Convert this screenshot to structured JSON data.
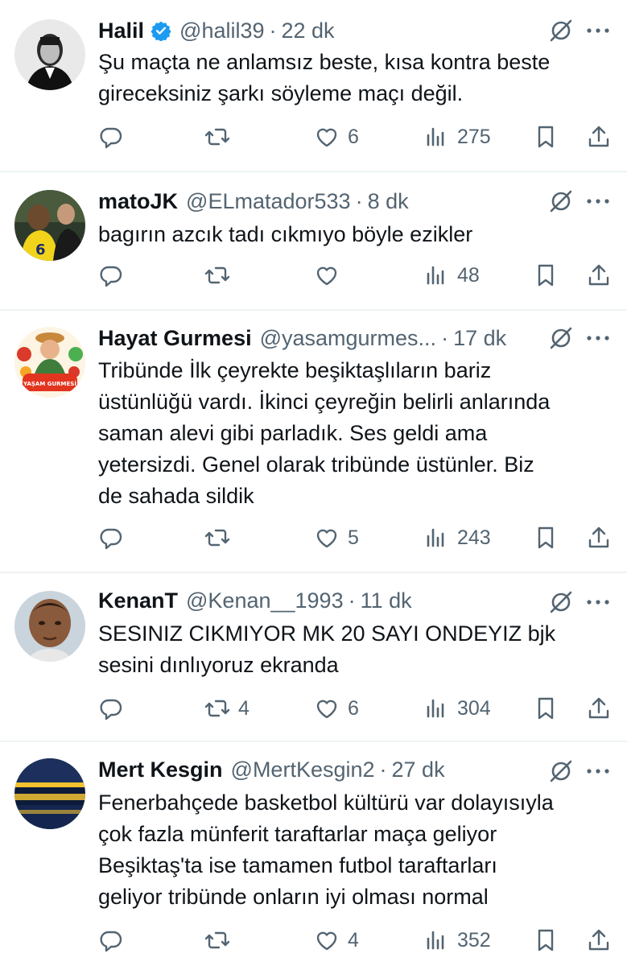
{
  "tweets": [
    {
      "name": "Halil",
      "verified": true,
      "handle": "@halil39",
      "time": "22 dk",
      "text": "Şu maçta ne anlamsız beste, kısa kontra beste\ngireceksiniz şarkı söyleme maçı değil.",
      "replies": "",
      "retweets": "",
      "likes": "6",
      "views": "275",
      "avatar": "portrait-bw"
    },
    {
      "name": "matoJK",
      "verified": false,
      "handle": "@ELmatador533",
      "time": "8 dk",
      "text": "bagırın azcık tadı cıkmıyo böyle ezikler",
      "replies": "",
      "retweets": "",
      "likes": "",
      "views": "48",
      "avatar": "football-players"
    },
    {
      "name": "Hayat Gurmesi",
      "verified": false,
      "handle": "@yasamgurmes...",
      "time": "17 dk",
      "text": "Tribünde İlk çeyrekte beşiktaşlıların bariz\nüstünlüğü vardı. İkinci çeyreğin belirli anlarında\nsaman alevi gibi parladık. Ses geldi ama\nyetersizdi. Genel olarak tribünde üstünler. Biz\nde sahada sildik",
      "replies": "",
      "retweets": "",
      "likes": "5",
      "views": "243",
      "avatar": "yasam-gurmesi-logo",
      "avatar_label": "YAŞAM GURMESİ"
    },
    {
      "name": "KenanT",
      "verified": false,
      "handle": "@Kenan__1993",
      "time": "11 dk",
      "text": "SESINIZ CIKMIYOR MK 20 SAYI ONDEYIZ bjk\nsesini dınlıyoruz ekranda",
      "replies": "",
      "retweets": "4",
      "likes": "6",
      "views": "304",
      "avatar": "man-portrait"
    },
    {
      "name": "Mert Kesgin",
      "verified": false,
      "handle": "@MertKesgin2",
      "time": "27 dk",
      "text": "Fenerbahçede basketbol kültürü var dolayısıyla\nçok fazla münferit taraftarlar maça geliyor\nBeşiktaş'ta ise tamamen futbol taraftarları\ngeliyor tribünde onların iyi olması normal",
      "replies": "",
      "retweets": "",
      "likes": "4",
      "views": "352",
      "avatar": "stadium-crowd"
    }
  ],
  "separator": "·",
  "colors": {
    "text": "#0f1419",
    "muted": "#536471",
    "verified": "#1d9bf0",
    "separator": "#eff3f4"
  },
  "icons": [
    "reply-icon",
    "retweet-icon",
    "like-icon",
    "views-icon",
    "bookmark-icon",
    "share-icon",
    "grok-icon",
    "more-icon",
    "verified-badge-icon"
  ]
}
